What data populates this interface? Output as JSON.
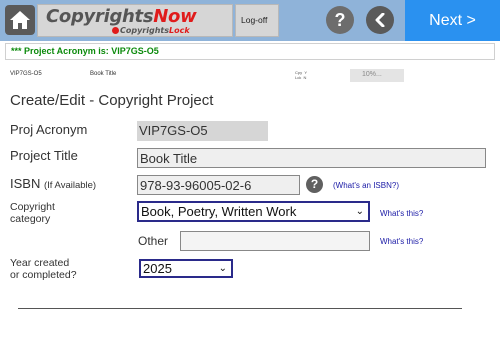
{
  "header": {
    "logo_part_a": "Copyrights",
    "logo_part_b": "Now",
    "logo_sub_a": "Copyrights",
    "logo_sub_b": "Lock",
    "logoff_label": "Log-off",
    "help_glyph": "?",
    "next_label": "Next >",
    "home_icon": "home-icon",
    "back_icon": "chevron-left-icon",
    "accent_color": "#2a91f0",
    "bar_color": "#8fb3d9"
  },
  "notice": {
    "text": "*** Project Acronym is: VIP7GS-O5"
  },
  "info": {
    "acronym": "VIP7GS-O5",
    "title": "Book Title",
    "cpy_label": "Cpy",
    "cpy_value": "Y",
    "lck_label": "Lck",
    "lck_value": "N",
    "progress_text": "10%..."
  },
  "page_title": "Create/Edit - Copyright Project",
  "form": {
    "acronym_label": "Proj Acronym",
    "acronym_value": "VIP7GS-O5",
    "title_label": "Project Title",
    "title_value": "Book Title",
    "isbn_label": "ISBN",
    "isbn_hint": "(If Available)",
    "isbn_value": "978-93-96005-02-6",
    "isbn_help_link": "(What's an ISBN?)",
    "category_label_line1": "Copyright",
    "category_label_line2": "category",
    "category_value": "Book, Poetry, Written Work",
    "category_help_link": "What's this?",
    "other_label": "Other",
    "other_value": "",
    "other_help_link": "What's this?",
    "year_label_line1": "Year created",
    "year_label_line2": "or completed?",
    "year_value": "2025"
  }
}
